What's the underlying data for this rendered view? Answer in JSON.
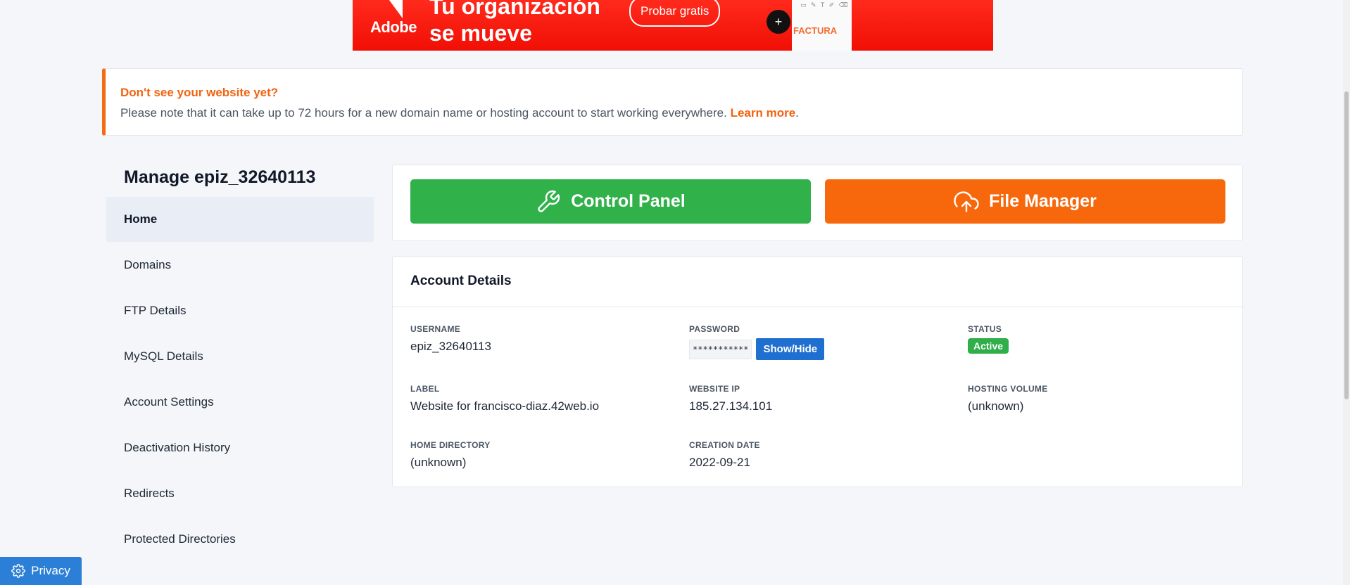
{
  "ad": {
    "brand": "Adobe",
    "headline_line1": "Tu organización",
    "headline_line2": "se mueve",
    "cta": "Probar gratis",
    "plus": "+",
    "doc_toolbar": "▭ ✎ T ✐ ⌫",
    "doc_title": "FACTURA"
  },
  "notice": {
    "title": "Don't see your website yet?",
    "text": "Please note that it can take up to 72 hours for a new domain name or hosting account to start working everywhere.",
    "link": "Learn more",
    "trail": "."
  },
  "sidebar": {
    "title": "Manage epiz_32640113",
    "items": [
      {
        "label": "Home",
        "active": true
      },
      {
        "label": "Domains"
      },
      {
        "label": "FTP Details"
      },
      {
        "label": "MySQL Details"
      },
      {
        "label": "Account Settings"
      },
      {
        "label": "Deactivation History"
      },
      {
        "label": "Redirects"
      },
      {
        "label": "Protected Directories"
      }
    ]
  },
  "actions": {
    "control_panel": "Control Panel",
    "file_manager": "File Manager"
  },
  "account": {
    "title": "Account Details",
    "username_label": "USERNAME",
    "username": "epiz_32640113",
    "password_label": "PASSWORD",
    "password_mask": "***********",
    "password_toggle": "Show/Hide",
    "status_label": "STATUS",
    "status": "Active",
    "label_label": "LABEL",
    "label": "Website for francisco-diaz.42web.io",
    "ip_label": "WEBSITE IP",
    "ip": "185.27.134.101",
    "volume_label": "HOSTING VOLUME",
    "volume": "(unknown)",
    "homedir_label": "HOME DIRECTORY",
    "homedir": "(unknown)",
    "created_label": "CREATION DATE",
    "created": "2022-09-21"
  },
  "privacy": {
    "label": "Privacy"
  },
  "colors": {
    "accent_orange": "#f7680d",
    "success_green": "#30b149",
    "primary_blue": "#1f6fd1"
  }
}
